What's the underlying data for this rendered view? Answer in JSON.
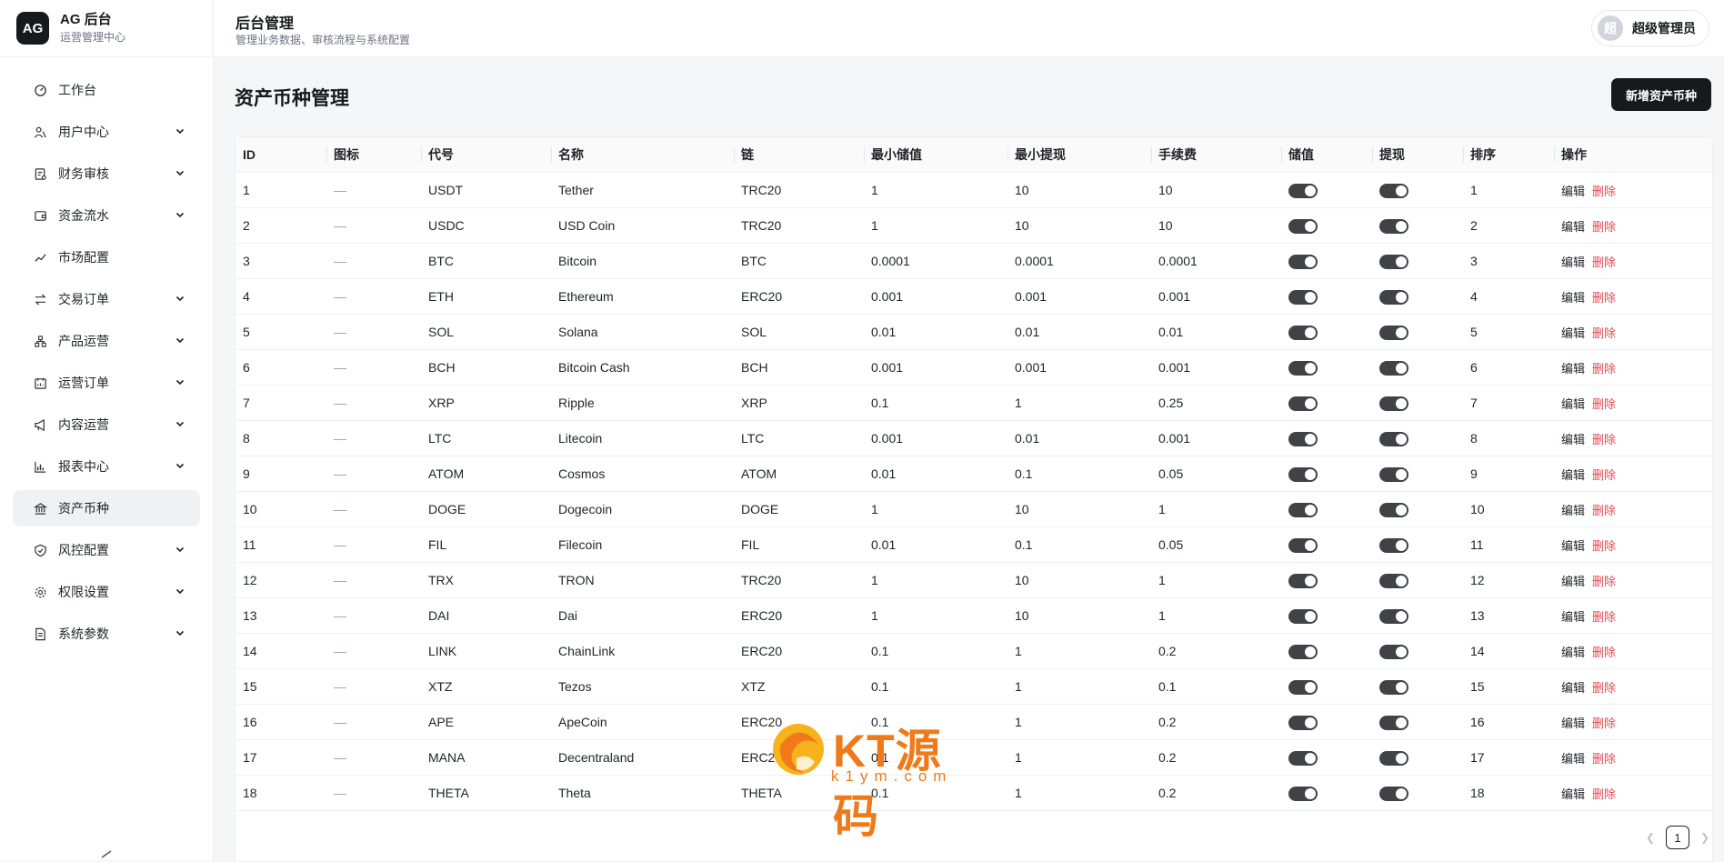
{
  "brand": {
    "logo": "AG",
    "title": "AG 后台",
    "subtitle": "运营管理中心"
  },
  "sidebar": {
    "items": [
      {
        "label": "工作台",
        "icon": "dashboard-icon",
        "expandable": false,
        "active": false
      },
      {
        "label": "用户中心",
        "icon": "users-icon",
        "expandable": true,
        "active": false
      },
      {
        "label": "财务审核",
        "icon": "finance-audit-icon",
        "expandable": true,
        "active": false
      },
      {
        "label": "资金流水",
        "icon": "wallet-icon",
        "expandable": true,
        "active": false
      },
      {
        "label": "市场配置",
        "icon": "trend-icon",
        "expandable": false,
        "active": false
      },
      {
        "label": "交易订单",
        "icon": "exchange-icon",
        "expandable": true,
        "active": false
      },
      {
        "label": "产品运营",
        "icon": "product-icon",
        "expandable": true,
        "active": false
      },
      {
        "label": "运营订单",
        "icon": "calendar-icon",
        "expandable": true,
        "active": false
      },
      {
        "label": "内容运营",
        "icon": "megaphone-icon",
        "expandable": true,
        "active": false
      },
      {
        "label": "报表中心",
        "icon": "bar-chart-icon",
        "expandable": true,
        "active": false
      },
      {
        "label": "资产币种",
        "icon": "bank-icon",
        "expandable": false,
        "active": true
      },
      {
        "label": "风控配置",
        "icon": "shield-icon",
        "expandable": true,
        "active": false
      },
      {
        "label": "权限设置",
        "icon": "gear-icon",
        "expandable": true,
        "active": false
      },
      {
        "label": "系统参数",
        "icon": "document-icon",
        "expandable": true,
        "active": false
      }
    ]
  },
  "header": {
    "title": "后台管理",
    "subtitle": "管理业务数据、审核流程与系统配置",
    "user": {
      "avatar": "超",
      "name": "超级管理员"
    }
  },
  "main": {
    "title": "资产币种管理",
    "add_button": "新增资产币种",
    "table": {
      "columns": [
        "ID",
        "图标",
        "代号",
        "名称",
        "链",
        "最小储值",
        "最小提现",
        "手续费",
        "储值",
        "提现",
        "排序",
        "操作"
      ],
      "edit_label": "编辑",
      "delete_label": "删除",
      "rows": [
        {
          "id": "1",
          "icon": "—",
          "code": "USDT",
          "name": "Tether",
          "chain": "TRC20",
          "min_deposit": "1",
          "min_withdraw": "10",
          "fee": "10",
          "deposit_enabled": true,
          "withdraw_enabled": true,
          "sort": "1"
        },
        {
          "id": "2",
          "icon": "—",
          "code": "USDC",
          "name": "USD Coin",
          "chain": "TRC20",
          "min_deposit": "1",
          "min_withdraw": "10",
          "fee": "10",
          "deposit_enabled": true,
          "withdraw_enabled": true,
          "sort": "2"
        },
        {
          "id": "3",
          "icon": "—",
          "code": "BTC",
          "name": "Bitcoin",
          "chain": "BTC",
          "min_deposit": "0.0001",
          "min_withdraw": "0.0001",
          "fee": "0.0001",
          "deposit_enabled": true,
          "withdraw_enabled": true,
          "sort": "3"
        },
        {
          "id": "4",
          "icon": "—",
          "code": "ETH",
          "name": "Ethereum",
          "chain": "ERC20",
          "min_deposit": "0.001",
          "min_withdraw": "0.001",
          "fee": "0.001",
          "deposit_enabled": true,
          "withdraw_enabled": true,
          "sort": "4"
        },
        {
          "id": "5",
          "icon": "—",
          "code": "SOL",
          "name": "Solana",
          "chain": "SOL",
          "min_deposit": "0.01",
          "min_withdraw": "0.01",
          "fee": "0.01",
          "deposit_enabled": true,
          "withdraw_enabled": true,
          "sort": "5"
        },
        {
          "id": "6",
          "icon": "—",
          "code": "BCH",
          "name": "Bitcoin Cash",
          "chain": "BCH",
          "min_deposit": "0.001",
          "min_withdraw": "0.001",
          "fee": "0.001",
          "deposit_enabled": true,
          "withdraw_enabled": true,
          "sort": "6"
        },
        {
          "id": "7",
          "icon": "—",
          "code": "XRP",
          "name": "Ripple",
          "chain": "XRP",
          "min_deposit": "0.1",
          "min_withdraw": "1",
          "fee": "0.25",
          "deposit_enabled": true,
          "withdraw_enabled": true,
          "sort": "7"
        },
        {
          "id": "8",
          "icon": "—",
          "code": "LTC",
          "name": "Litecoin",
          "chain": "LTC",
          "min_deposit": "0.001",
          "min_withdraw": "0.01",
          "fee": "0.001",
          "deposit_enabled": true,
          "withdraw_enabled": true,
          "sort": "8"
        },
        {
          "id": "9",
          "icon": "—",
          "code": "ATOM",
          "name": "Cosmos",
          "chain": "ATOM",
          "min_deposit": "0.01",
          "min_withdraw": "0.1",
          "fee": "0.05",
          "deposit_enabled": true,
          "withdraw_enabled": true,
          "sort": "9"
        },
        {
          "id": "10",
          "icon": "—",
          "code": "DOGE",
          "name": "Dogecoin",
          "chain": "DOGE",
          "min_deposit": "1",
          "min_withdraw": "10",
          "fee": "1",
          "deposit_enabled": true,
          "withdraw_enabled": true,
          "sort": "10"
        },
        {
          "id": "11",
          "icon": "—",
          "code": "FIL",
          "name": "Filecoin",
          "chain": "FIL",
          "min_deposit": "0.01",
          "min_withdraw": "0.1",
          "fee": "0.05",
          "deposit_enabled": true,
          "withdraw_enabled": true,
          "sort": "11"
        },
        {
          "id": "12",
          "icon": "—",
          "code": "TRX",
          "name": "TRON",
          "chain": "TRC20",
          "min_deposit": "1",
          "min_withdraw": "10",
          "fee": "1",
          "deposit_enabled": true,
          "withdraw_enabled": true,
          "sort": "12"
        },
        {
          "id": "13",
          "icon": "—",
          "code": "DAI",
          "name": "Dai",
          "chain": "ERC20",
          "min_deposit": "1",
          "min_withdraw": "10",
          "fee": "1",
          "deposit_enabled": true,
          "withdraw_enabled": true,
          "sort": "13"
        },
        {
          "id": "14",
          "icon": "—",
          "code": "LINK",
          "name": "ChainLink",
          "chain": "ERC20",
          "min_deposit": "0.1",
          "min_withdraw": "1",
          "fee": "0.2",
          "deposit_enabled": true,
          "withdraw_enabled": true,
          "sort": "14"
        },
        {
          "id": "15",
          "icon": "—",
          "code": "XTZ",
          "name": "Tezos",
          "chain": "XTZ",
          "min_deposit": "0.1",
          "min_withdraw": "1",
          "fee": "0.1",
          "deposit_enabled": true,
          "withdraw_enabled": true,
          "sort": "15"
        },
        {
          "id": "16",
          "icon": "—",
          "code": "APE",
          "name": "ApeCoin",
          "chain": "ERC20",
          "min_deposit": "0.1",
          "min_withdraw": "1",
          "fee": "0.2",
          "deposit_enabled": true,
          "withdraw_enabled": true,
          "sort": "16"
        },
        {
          "id": "17",
          "icon": "—",
          "code": "MANA",
          "name": "Decentraland",
          "chain": "ERC20",
          "min_deposit": "0.1",
          "min_withdraw": "1",
          "fee": "0.2",
          "deposit_enabled": true,
          "withdraw_enabled": true,
          "sort": "17"
        },
        {
          "id": "18",
          "icon": "—",
          "code": "THETA",
          "name": "Theta",
          "chain": "THETA",
          "min_deposit": "0.1",
          "min_withdraw": "1",
          "fee": "0.2",
          "deposit_enabled": true,
          "withdraw_enabled": true,
          "sort": "18"
        }
      ]
    },
    "pagination": {
      "current_page": "1"
    }
  },
  "watermark": {
    "text": "KT源码",
    "url": "k1ym.com"
  },
  "colors": {
    "accent": "#17191c",
    "danger": "#e5484d",
    "toggle_on": "#3f4246",
    "watermark": "#f07a1a"
  }
}
